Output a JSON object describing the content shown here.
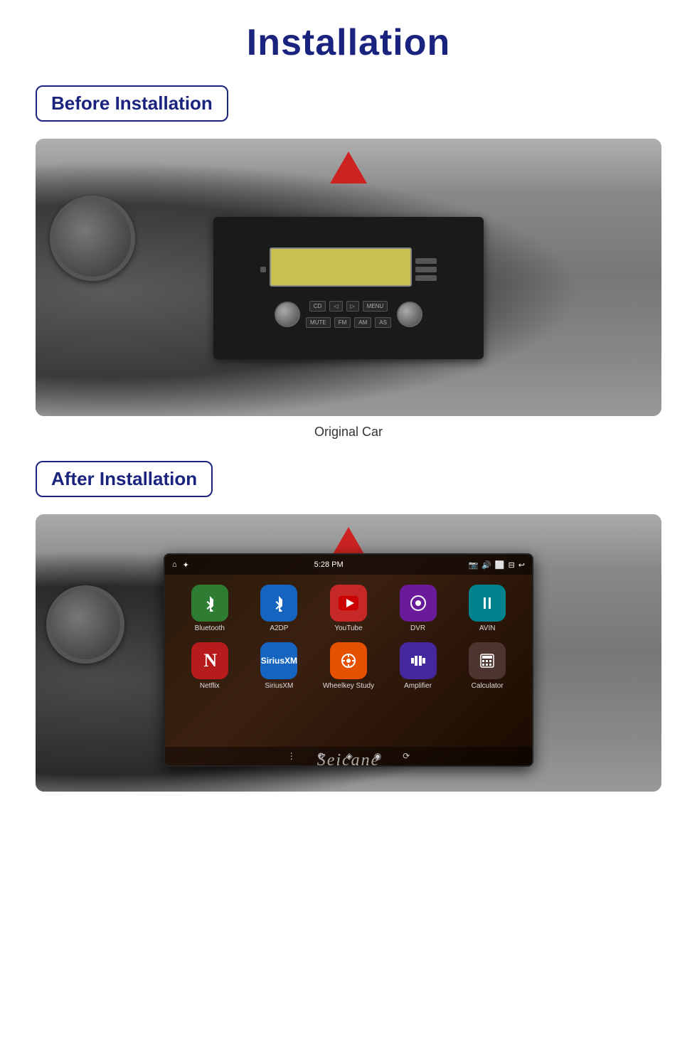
{
  "page": {
    "title": "Installation"
  },
  "before_section": {
    "badge_text": "Before Installation",
    "caption": "Original Car"
  },
  "after_section": {
    "badge_text": "After Installation"
  },
  "android_screen": {
    "statusbar": {
      "time": "5:28 PM"
    },
    "apps_row1": [
      {
        "label": "Bluetooth",
        "icon": "⚡",
        "bg": "bg-green"
      },
      {
        "label": "A2DP",
        "icon": "✱",
        "bg": "bg-blue-bt"
      },
      {
        "label": "YouTube",
        "icon": "▶",
        "bg": "bg-red-yt"
      },
      {
        "label": "DVR",
        "icon": "◎",
        "bg": "bg-purple-dvr"
      },
      {
        "label": "AVIN",
        "icon": "↕",
        "bg": "bg-cyan-avin"
      }
    ],
    "apps_row2": [
      {
        "label": "Netflix",
        "icon": "N",
        "bg": "bg-red-netflix"
      },
      {
        "label": "SiriusXM",
        "icon": "S",
        "bg": "bg-blue-sirius"
      },
      {
        "label": "Wheelkey Study",
        "icon": "⊕",
        "bg": "bg-orange-wheel"
      },
      {
        "label": "Amplifier",
        "icon": "▌▌",
        "bg": "bg-purple-amp"
      },
      {
        "label": "Calculator",
        "icon": "▦",
        "bg": "bg-brown-calc"
      }
    ],
    "brand": "Seicane"
  }
}
